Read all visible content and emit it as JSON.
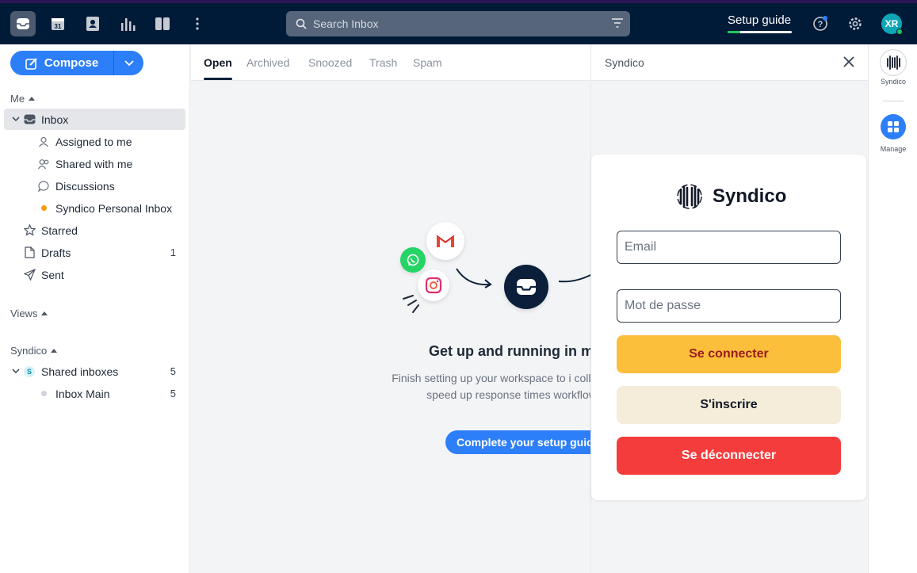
{
  "topbar": {
    "search_placeholder": "Search Inbox",
    "setup_label": "Setup guide",
    "setup_progress": 0.2,
    "avatar_initials": "XR",
    "calendar_day": "31"
  },
  "compose": {
    "label": "Compose"
  },
  "sidebar": {
    "me_header": "Me",
    "inbox": "Inbox",
    "items": [
      {
        "label": "Assigned to me"
      },
      {
        "label": "Shared with me"
      },
      {
        "label": "Discussions"
      },
      {
        "label": "Syndico Personal Inbox"
      }
    ],
    "starred": "Starred",
    "drafts": "Drafts",
    "drafts_count": "1",
    "sent": "Sent",
    "views_header": "Views",
    "syndico_header": "Syndico",
    "shared_inboxes": "Shared inboxes",
    "shared_inboxes_badge": "S",
    "shared_inboxes_count": "5",
    "inbox_main": "Inbox Main",
    "inbox_main_count": "5"
  },
  "tabs": [
    "Open",
    "Archived",
    "Snoozed",
    "Trash",
    "Spam"
  ],
  "empty_state": {
    "title": "Get up and running in mi",
    "description": "Finish setting up your workspace to i collaboration, speed up response times workflows.",
    "button": "Complete your setup guid"
  },
  "panel": {
    "title": "Syndico",
    "brand": "Syndico",
    "email_placeholder": "Email",
    "password_placeholder": "Mot de passe",
    "login_button": "Se connecter",
    "signup_button": "S'inscrire",
    "logout_button": "Se déconnecter"
  },
  "rail": {
    "app_label": "Syndico",
    "manage_label": "Manage"
  },
  "colors": {
    "topbar": "#001b38",
    "accent": "#2d7ff9",
    "login": "#fbbf3c",
    "signup": "#f5edda",
    "logout": "#f53c3c"
  }
}
